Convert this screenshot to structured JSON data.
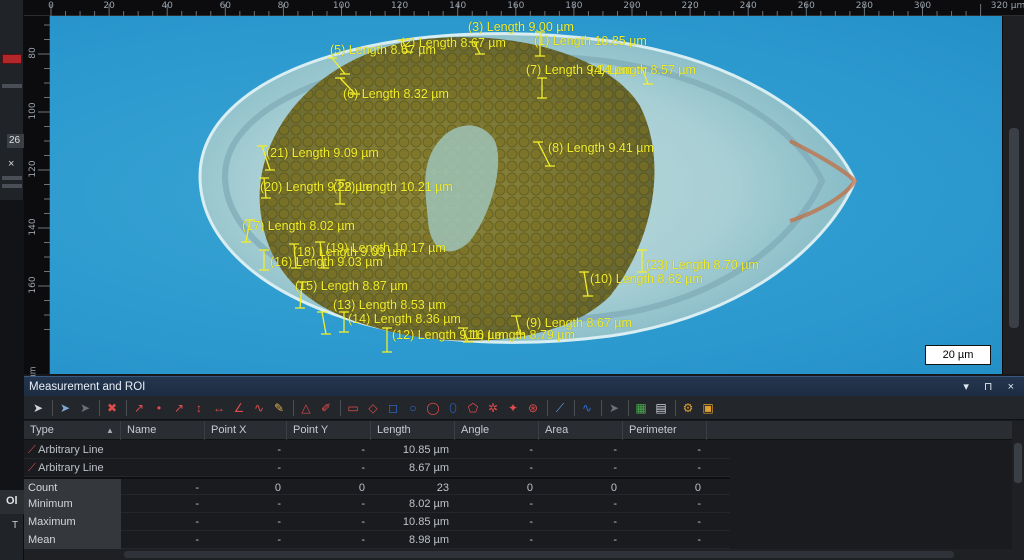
{
  "left_strip": {
    "number": "26",
    "close_glyph": "×",
    "section_label": "Ol",
    "t_label": "T"
  },
  "ruler": {
    "x_ticks": [
      "0",
      "20",
      "40",
      "60",
      "80",
      "100",
      "120",
      "140",
      "160",
      "180",
      "200",
      "220",
      "240",
      "260",
      "280",
      "300",
      "320 µm"
    ],
    "y_ticks": [
      "80",
      "100",
      "120",
      "140",
      "160"
    ],
    "y_unit": "µm"
  },
  "image": {
    "scalebar_label": "20 µm",
    "measurements": [
      {
        "text": "(1) Length 10.85 µm"
      },
      {
        "text": "(2) Length 8.67 µm"
      },
      {
        "text": "(3) Length 9.00 µm"
      },
      {
        "text": "(4) Length 8.57 µm"
      },
      {
        "text": "(5) Length 8.67 µm"
      },
      {
        "text": "(6) Length 8.32 µm"
      },
      {
        "text": "(7) Length 9.14 µm"
      },
      {
        "text": "(8) Length 9.41 µm"
      },
      {
        "text": "(9) Length 8.67 µm"
      },
      {
        "text": "(10) Length 8.62 µm"
      },
      {
        "text": "(11) Length 8.79 µm"
      },
      {
        "text": "(12) Length 9.16 µm"
      },
      {
        "text": "(13) Length 8.53 µm"
      },
      {
        "text": "(14) Length 8.36 µm"
      },
      {
        "text": "(15) Length 8.87 µm"
      },
      {
        "text": "(16) Length 9.03 µm"
      },
      {
        "text": "(17) Length 8.02 µm"
      },
      {
        "text": "(18) Length 9.03 µm"
      },
      {
        "text": "(19) Length 10.17 µm"
      },
      {
        "text": "(20) Length 9.28 µm"
      },
      {
        "text": "(21) Length 9.09 µm"
      },
      {
        "text": "(22) Length 10.21 µm"
      },
      {
        "text": "(23) Length 8.70 µm"
      }
    ]
  },
  "panel": {
    "title": "Measurement and ROI",
    "title_controls": "▾ ⊓ ×",
    "columns": [
      "Type",
      "Name",
      "Point X",
      "Point Y",
      "Length",
      "Angle",
      "Area",
      "Perimeter"
    ],
    "type_sort_glyph": "▲",
    "rows": [
      {
        "type": "Arbitrary Line",
        "name": "",
        "px": "-",
        "py": "-",
        "length": "10.85 µm",
        "angle": "-",
        "area": "-",
        "perimeter": "-"
      },
      {
        "type": "Arbitrary Line",
        "name": "",
        "px": "-",
        "py": "-",
        "length": "8.67 µm",
        "angle": "-",
        "area": "-",
        "perimeter": "-"
      }
    ],
    "summary": [
      {
        "label": "Count",
        "name": "-",
        "px": "0",
        "py": "0",
        "length": "23",
        "angle": "0",
        "area": "0",
        "perimeter": "0"
      },
      {
        "label": "Minimum",
        "name": "-",
        "px": "-",
        "py": "-",
        "length": "8.02 µm",
        "angle": "-",
        "area": "-",
        "perimeter": "-"
      },
      {
        "label": "Maximum",
        "name": "-",
        "px": "-",
        "py": "-",
        "length": "10.85 µm",
        "angle": "-",
        "area": "-",
        "perimeter": "-"
      },
      {
        "label": "Mean",
        "name": "-",
        "px": "-",
        "py": "-",
        "length": "8.98 µm",
        "angle": "-",
        "area": "-",
        "perimeter": "-"
      }
    ]
  },
  "colors": {
    "label": "#f2ee2a",
    "background": "#2e9bd0",
    "title_bar": "#24364f"
  }
}
